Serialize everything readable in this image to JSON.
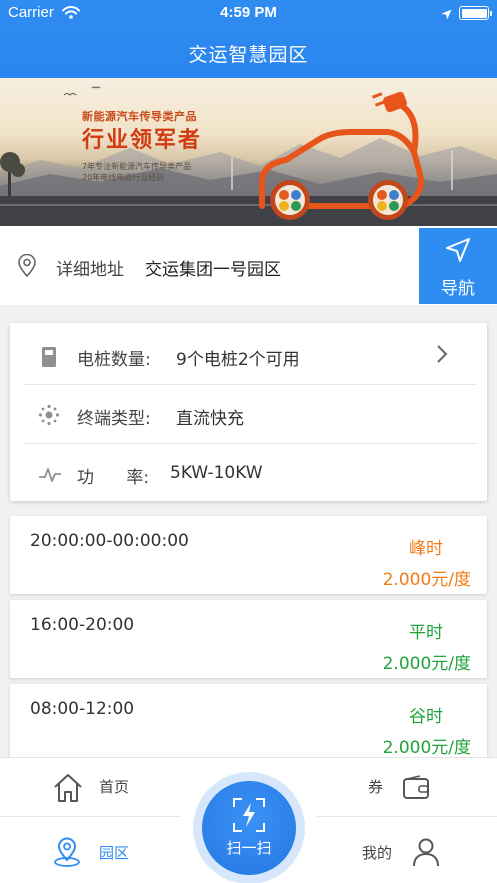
{
  "status_bar": {
    "carrier": "Carrier",
    "time": "4:59 PM",
    "icons": [
      "wifi-icon",
      "location-arrow-icon",
      "battery-icon"
    ]
  },
  "nav": {
    "title": "交运智慧园区"
  },
  "banner": {
    "subtitle": "新能源汽车传导类产品",
    "headline": "行业领军者",
    "line1": "7年专注新能源汽车传导类产品",
    "line2": "20年电线电缆行业经验"
  },
  "address": {
    "icon": "location-pin-icon",
    "label": "详细地址",
    "value": "交运集团一号园区",
    "nav_button_label": "导航",
    "nav_button_icon": "navigation-arrow-icon"
  },
  "info": {
    "pile_count": {
      "label": "电桩数量:",
      "value": "9个电桩2个可用",
      "icon": "charging-pile-icon"
    },
    "terminal_type": {
      "label": "终端类型:",
      "value": "直流快充",
      "icon": "terminal-icon"
    },
    "power": {
      "label": "功      率:",
      "value": "5KW-10KW",
      "icon": "power-wave-icon"
    }
  },
  "prices": [
    {
      "time": "20:00:00-00:00:00",
      "type": "峰时",
      "rate": "2.000元/度",
      "color": "#f07c18"
    },
    {
      "time": "16:00-20:00",
      "type": "平时",
      "rate": "2.000元/度",
      "color": "#1fa33b"
    },
    {
      "time": "08:00-12:00",
      "type": "谷时",
      "rate": "2.000元/度",
      "color": "#1fa33b"
    }
  ],
  "tabs": {
    "home": "首页",
    "coupon": "券",
    "park": "园区",
    "mine": "我的",
    "scan": "扫一扫"
  },
  "colors": {
    "primary": "#2f8cf0",
    "peak": "#f07c18",
    "flat": "#1fa33b"
  }
}
